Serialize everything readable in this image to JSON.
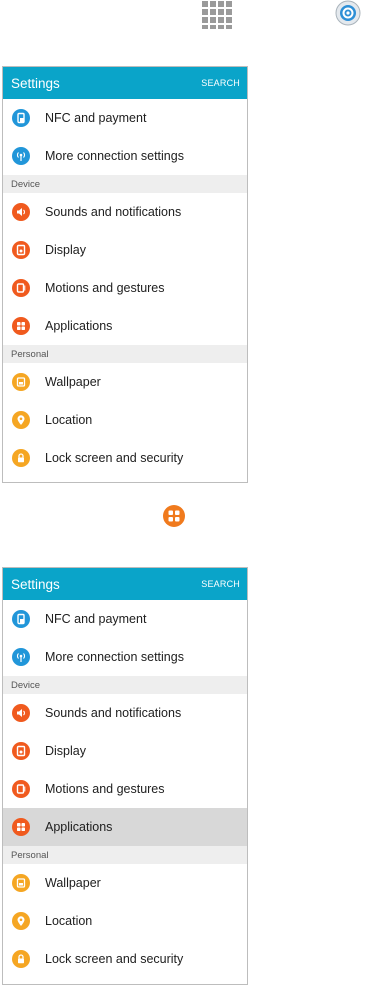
{
  "colors": {
    "appbar": "#0aa4c9",
    "blue": "#2196d9",
    "orange_red": "#f05a1e",
    "orange": "#f07a1d",
    "amber": "#f5a623",
    "section_bg": "#eeeeee",
    "selected_bg": "#d8d8d8"
  },
  "top_icons": {
    "apps": "apps-grid-icon",
    "settings": "settings-gear-icon",
    "applications": "applications-icon"
  },
  "panels": [
    {
      "title": "Settings",
      "action": "SEARCH",
      "items": [
        {
          "label": "NFC and payment",
          "icon": "nfc-icon"
        },
        {
          "label": "More connection settings",
          "icon": "wifi-tower-icon"
        },
        {
          "section": "Device"
        },
        {
          "label": "Sounds and notifications",
          "icon": "volume-icon"
        },
        {
          "label": "Display",
          "icon": "display-icon"
        },
        {
          "label": "Motions and gestures",
          "icon": "motion-icon"
        },
        {
          "label": "Applications",
          "icon": "applications-icon"
        },
        {
          "section": "Personal"
        },
        {
          "label": "Wallpaper",
          "icon": "wallpaper-icon"
        },
        {
          "label": "Location",
          "icon": "location-pin-icon"
        },
        {
          "label": "Lock screen and security",
          "icon": "lock-icon"
        }
      ]
    },
    {
      "title": "Settings",
      "action": "SEARCH",
      "items": [
        {
          "label": "NFC and payment",
          "icon": "nfc-icon"
        },
        {
          "label": "More connection settings",
          "icon": "wifi-tower-icon"
        },
        {
          "section": "Device"
        },
        {
          "label": "Sounds and notifications",
          "icon": "volume-icon"
        },
        {
          "label": "Display",
          "icon": "display-icon"
        },
        {
          "label": "Motions and gestures",
          "icon": "motion-icon"
        },
        {
          "label": "Applications",
          "icon": "applications-icon",
          "selected": true
        },
        {
          "section": "Personal"
        },
        {
          "label": "Wallpaper",
          "icon": "wallpaper-icon"
        },
        {
          "label": "Location",
          "icon": "location-pin-icon"
        },
        {
          "label": "Lock screen and security",
          "icon": "lock-icon"
        }
      ]
    }
  ]
}
